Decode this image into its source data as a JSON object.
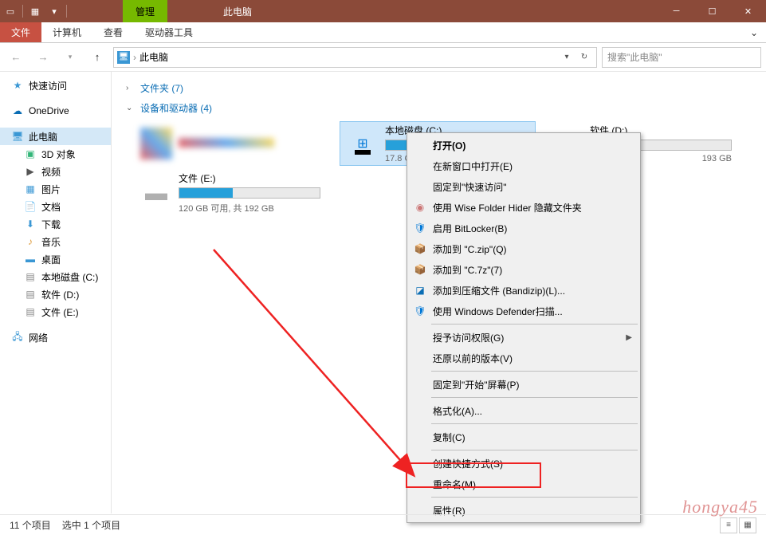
{
  "window": {
    "contextual_tab": "管理",
    "title": "此电脑"
  },
  "ribbon": {
    "tabs": [
      "文件",
      "计算机",
      "查看",
      "驱动器工具"
    ],
    "active": 0
  },
  "address": {
    "location": "此电脑",
    "search_placeholder": "搜索\"此电脑\""
  },
  "sidebar": {
    "quick": "快速访问",
    "onedrive": "OneDrive",
    "thispc": "此电脑",
    "children": [
      "3D 对象",
      "视频",
      "图片",
      "文档",
      "下载",
      "音乐",
      "桌面",
      "本地磁盘 (C:)",
      "软件 (D:)",
      "文件 (E:)"
    ],
    "network": "网络"
  },
  "groups": {
    "folders": "文件夹 (7)",
    "drives": "设备和驱动器 (4)"
  },
  "drives": {
    "removable": {
      "name": "",
      "sub": ""
    },
    "c": {
      "name": "本地磁盘 (C:)",
      "sub": "17.8 GB"
    },
    "d": {
      "name": "软件 (D:)",
      "sub": "193 GB"
    },
    "e": {
      "name": "文件 (E:)",
      "sub": "120 GB 可用, 共 192 GB"
    }
  },
  "context_menu": {
    "open": "打开(O)",
    "open_new": "在新窗口中打开(E)",
    "pin_quick": "固定到\"快速访问\"",
    "wise": "使用 Wise Folder Hider 隐藏文件夹",
    "bitlocker": "启用 BitLocker(B)",
    "czip": "添加到 \"C.zip\"(Q)",
    "c7z": "添加到 \"C.7z\"(7)",
    "bandizip": "添加到压缩文件 (Bandizip)(L)...",
    "defender": "使用 Windows Defender扫描...",
    "grant": "授予访问权限(G)",
    "restore": "还原以前的版本(V)",
    "pin_start": "固定到\"开始\"屏幕(P)",
    "format": "格式化(A)...",
    "copy": "复制(C)",
    "shortcut": "创建快捷方式(S)",
    "rename": "重命名(M)",
    "properties": "属性(R)"
  },
  "status": {
    "items": "11 个项目",
    "selected": "选中 1 个项目"
  },
  "watermark": "hongya45"
}
